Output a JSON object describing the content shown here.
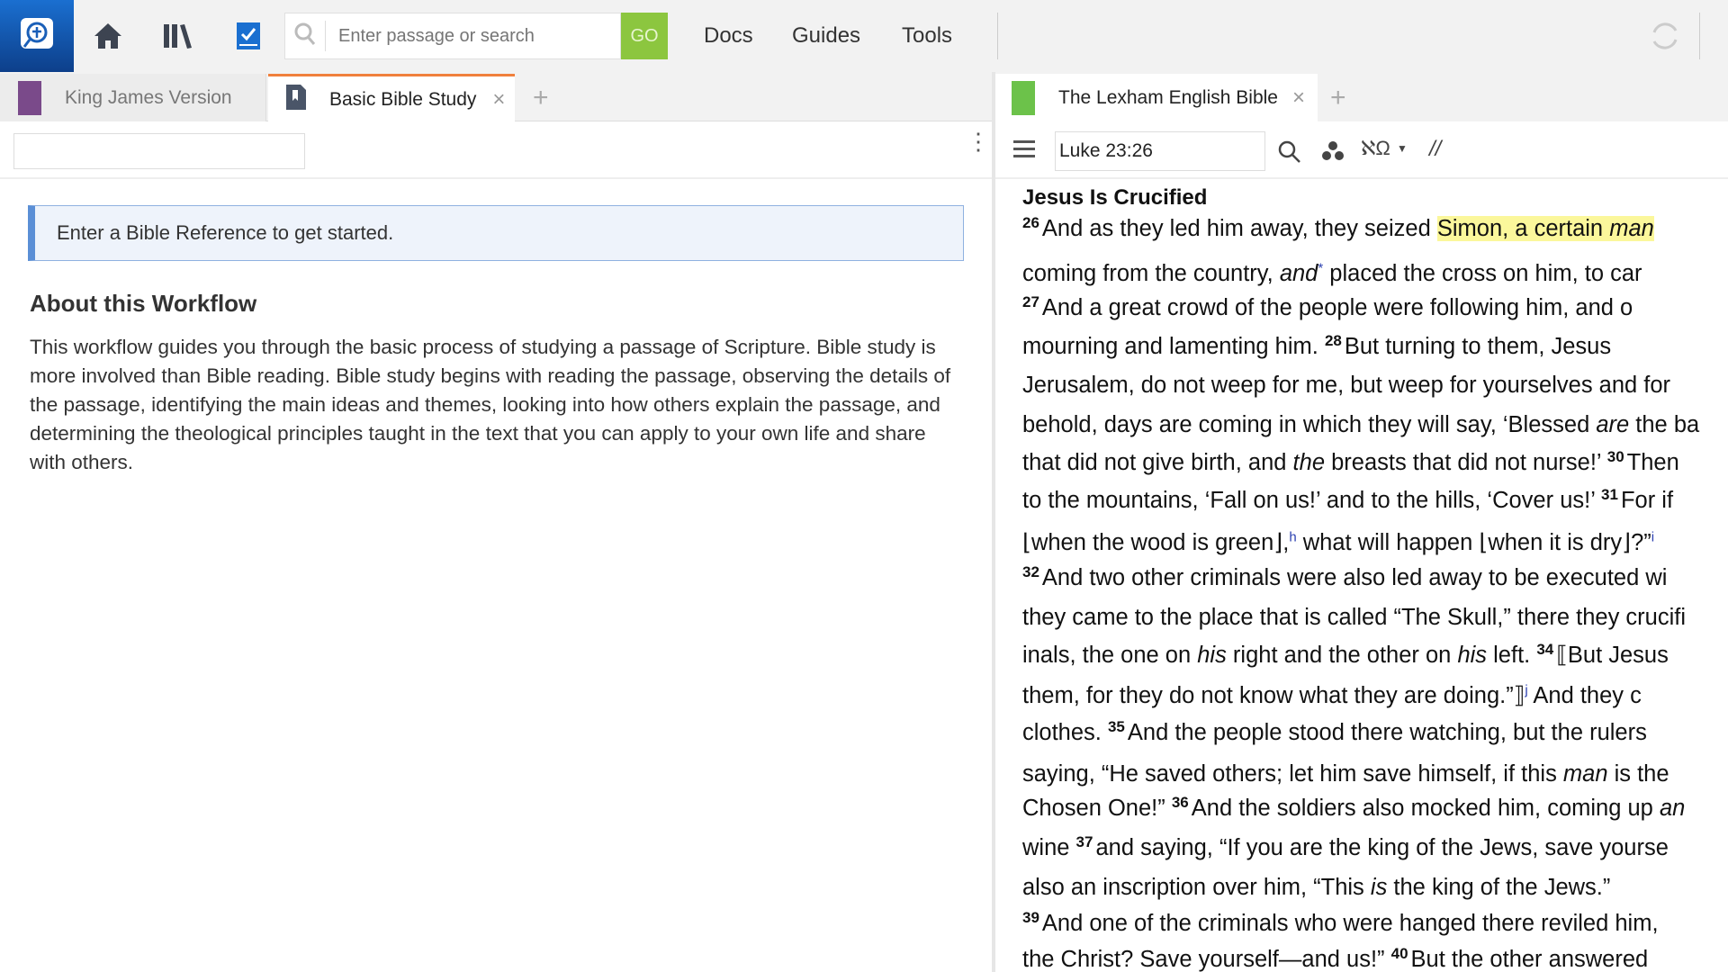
{
  "topbar": {
    "search_placeholder": "Enter passage or search",
    "go_label": "GO",
    "menus": [
      "Docs",
      "Guides",
      "Tools"
    ]
  },
  "left_panel": {
    "tabs": [
      {
        "label": "King James Version",
        "active": false
      },
      {
        "label": "Basic Bible Study",
        "active": true
      }
    ],
    "reference_input_value": "",
    "info_message": "Enter a Bible Reference to get started.",
    "about_title": "About this Workflow",
    "about_text": "This workflow guides you through the basic process of studying a passage of Scripture. Bible study is more involved than Bible reading. Bible study begins with reading the passage, observing the details of the passage, identifying the main ideas and themes, looking into how others explain the passage, and determining the theological principles taught in the text that you can apply to your own life and share with others."
  },
  "right_panel": {
    "tab_label": "The Lexham English Bible",
    "reference_value": "Luke 23:26",
    "lines": [
      [
        {
          "t": "Jesus Is Crucified",
          "s": "h"
        }
      ],
      [
        {
          "t": "26",
          "s": "v"
        },
        {
          "t": "And as they led him away, they seized "
        },
        {
          "t": "Simon, a certain ",
          "s": "hl"
        },
        {
          "t": "man",
          "s": "hl i"
        }
      ],
      [
        {
          "t": "coming from the country, "
        },
        {
          "t": "and",
          "s": "i"
        },
        {
          "t": "*",
          "s": "fn"
        },
        {
          "t": " placed the cross on him, to car"
        }
      ],
      [
        {
          "t": "27",
          "s": "v"
        },
        {
          "t": "And a great crowd of the people were following him, and o"
        }
      ],
      [
        {
          "t": "mourning and lamenting him. "
        },
        {
          "t": "28",
          "s": "v"
        },
        {
          "t": "But turning to them, Jesus"
        }
      ],
      [
        {
          "t": "Jerusalem, do not weep for me, but weep for yourselves and for"
        }
      ],
      [
        {
          "t": "behold, days are coming in which they will say, ‘Blessed "
        },
        {
          "t": "are",
          "s": "i"
        },
        {
          "t": " the ba"
        }
      ],
      [
        {
          "t": "that did not give birth, and "
        },
        {
          "t": "the",
          "s": "i"
        },
        {
          "t": " breasts that did not nurse!’ "
        },
        {
          "t": "30",
          "s": "v"
        },
        {
          "t": "Then"
        }
      ],
      [
        {
          "t": "to the mountains, ‘Fall on us!’ and to the hills, ‘Cover us!’ "
        },
        {
          "t": "31",
          "s": "v"
        },
        {
          "t": "For if"
        }
      ],
      [
        {
          "t": "⌊when the wood is green⌋,"
        },
        {
          "t": "h",
          "s": "fn"
        },
        {
          "t": " what will happen ⌊when it is dry⌋?”"
        },
        {
          "t": "i",
          "s": "fn"
        }
      ],
      [
        {
          "t": "32",
          "s": "v"
        },
        {
          "t": "And two other criminals were also led away to be executed wi"
        }
      ],
      [
        {
          "t": "they came to the place that is called “The Skull,” there they crucifi"
        }
      ],
      [
        {
          "t": "inals, the one on "
        },
        {
          "t": "his",
          "s": "i"
        },
        {
          "t": " right and the other on "
        },
        {
          "t": "his",
          "s": "i"
        },
        {
          "t": " left. "
        },
        {
          "t": "34",
          "s": "v"
        },
        {
          "t": "⟦But Jesus"
        }
      ],
      [
        {
          "t": "them, for they do not know what they are doing.”⟧"
        },
        {
          "t": "j",
          "s": "fn"
        },
        {
          "t": " And they c"
        }
      ],
      [
        {
          "t": "clothes. "
        },
        {
          "t": "35",
          "s": "v"
        },
        {
          "t": "And the people stood there watching, but the rulers"
        }
      ],
      [
        {
          "t": "saying, “He saved others; let him save himself, if this "
        },
        {
          "t": "man",
          "s": "i"
        },
        {
          "t": " is the"
        }
      ],
      [
        {
          "t": "Chosen One!” "
        },
        {
          "t": "36",
          "s": "v"
        },
        {
          "t": "And the soldiers also mocked him, coming up "
        },
        {
          "t": "an",
          "s": "i"
        }
      ],
      [
        {
          "t": "wine "
        },
        {
          "t": "37",
          "s": "v"
        },
        {
          "t": "and saying, “If you are the king of the Jews, save yourse"
        }
      ],
      [
        {
          "t": "also an inscription over him, “This "
        },
        {
          "t": "is",
          "s": "i"
        },
        {
          "t": " the king of the Jews.”"
        }
      ],
      [
        {
          "t": "39",
          "s": "v"
        },
        {
          "t": "And one of the criminals who were hanged there reviled him,"
        }
      ],
      [
        {
          "t": "the Christ? Save yourself—and us!” "
        },
        {
          "t": "40",
          "s": "v"
        },
        {
          "t": "But the other answered"
        }
      ]
    ]
  },
  "colors": {
    "accent_blue": "#1a6fd0",
    "go_green": "#8cc63f",
    "active_tab": "#f0803c",
    "highlight": "#fbf79b"
  }
}
